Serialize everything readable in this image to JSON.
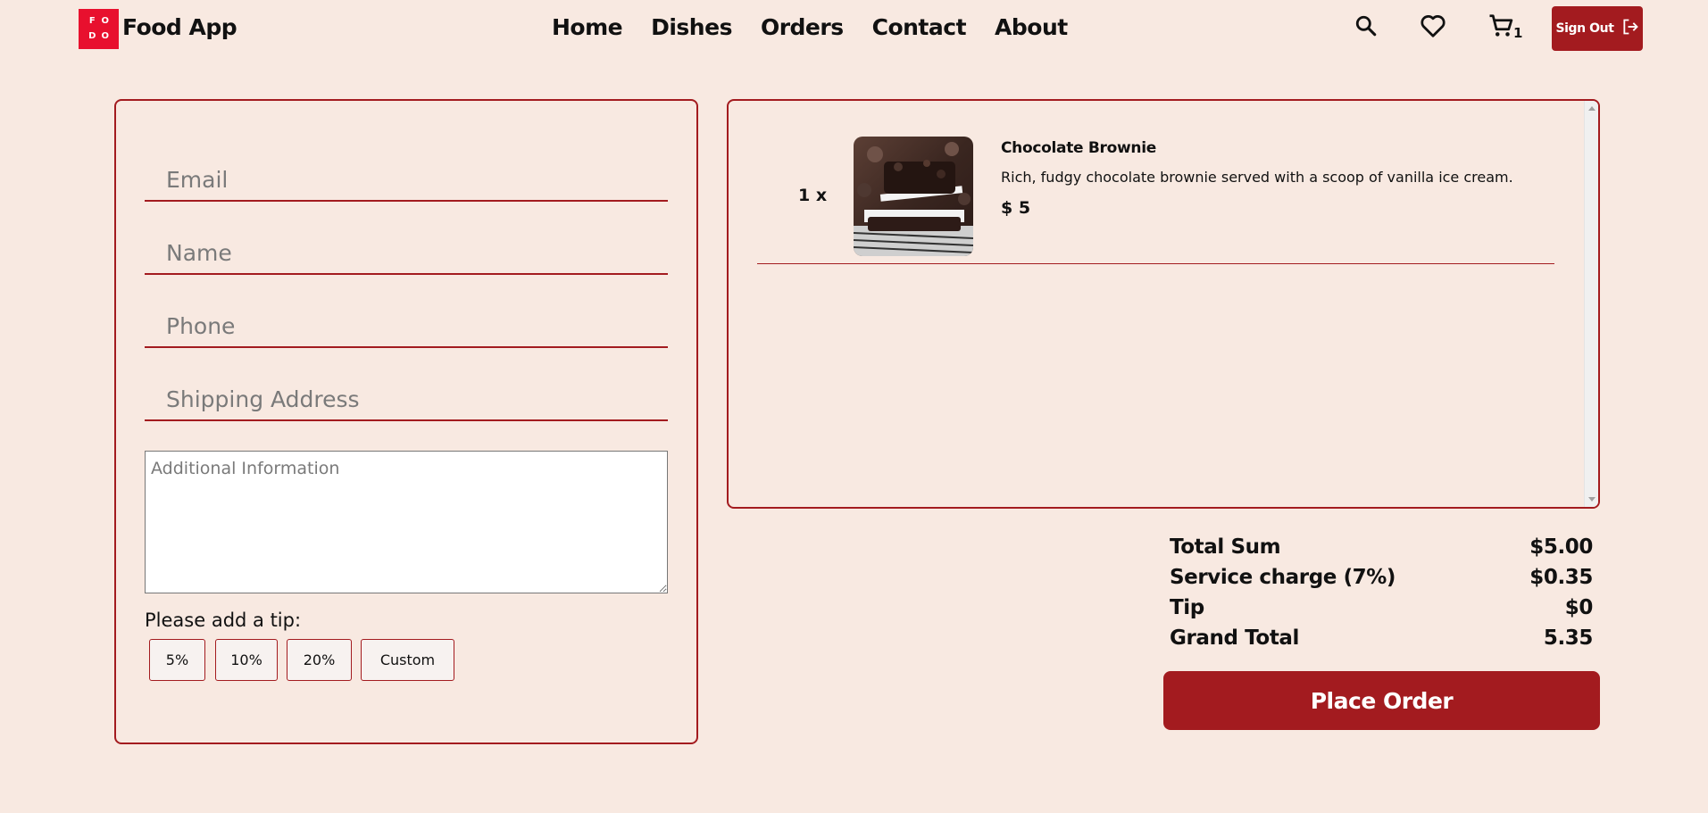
{
  "header": {
    "logo_letters": [
      "F",
      "O",
      "D",
      "O"
    ],
    "brand": "Food App",
    "nav": [
      "Home",
      "Dishes",
      "Orders",
      "Contact",
      "About"
    ],
    "cart_count": "1",
    "signout_label": "Sign Out",
    "icons": [
      "search-icon",
      "heart-icon",
      "cart-icon",
      "logout-icon"
    ]
  },
  "form": {
    "email_placeholder": "Email",
    "name_placeholder": "Name",
    "phone_placeholder": "Phone",
    "address_placeholder": "Shipping Address",
    "additional_placeholder": "Additional Information",
    "tip_label": "Please add a tip:",
    "tip_options": [
      "5%",
      "10%",
      "20%",
      "Custom"
    ]
  },
  "cart": {
    "items": [
      {
        "quantity": "1 x",
        "name": "Chocolate Brownie",
        "description": "Rich, fudgy chocolate brownie served with a scoop of vanilla ice cream.",
        "price": "$ 5"
      }
    ]
  },
  "summary": {
    "rows": [
      {
        "label": "Total Sum",
        "value": "$5.00"
      },
      {
        "label": "Service charge (7%)",
        "value": "$0.35"
      },
      {
        "label": "Tip",
        "value": "$0"
      },
      {
        "label": "Grand Total",
        "value": "5.35"
      }
    ],
    "place_order_label": "Place Order"
  },
  "colors": {
    "background": "#f8e9e1",
    "accent": "#a31b1f",
    "logo_red": "#e8102e"
  }
}
